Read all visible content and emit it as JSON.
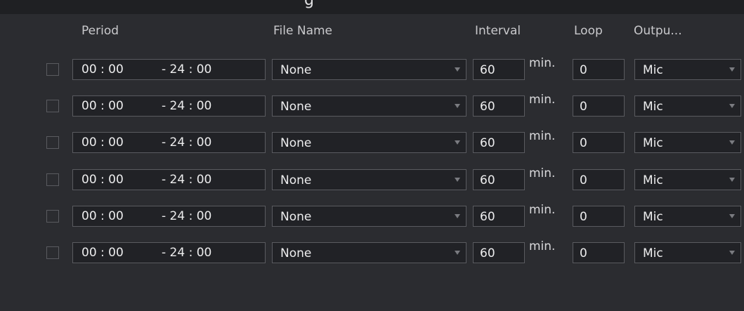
{
  "dialog": {
    "title_fragment": "g"
  },
  "headers": {
    "period": "Period",
    "file_name": "File Name",
    "interval": "Interval",
    "loop": "Loop",
    "output": "Outpu..."
  },
  "rows": [
    {
      "start": "00 : 00",
      "end": "- 24 : 00",
      "file": "None",
      "interval": "60",
      "unit": "min.",
      "loop": "0",
      "output": "Mic",
      "checked": false
    },
    {
      "start": "00 : 00",
      "end": "- 24 : 00",
      "file": "None",
      "interval": "60",
      "unit": "min.",
      "loop": "0",
      "output": "Mic",
      "checked": false
    },
    {
      "start": "00 : 00",
      "end": "- 24 : 00",
      "file": "None",
      "interval": "60",
      "unit": "min.",
      "loop": "0",
      "output": "Mic",
      "checked": false
    },
    {
      "start": "00 : 00",
      "end": "- 24 : 00",
      "file": "None",
      "interval": "60",
      "unit": "min.",
      "loop": "0",
      "output": "Mic",
      "checked": false
    },
    {
      "start": "00 : 00",
      "end": "- 24 : 00",
      "file": "None",
      "interval": "60",
      "unit": "min.",
      "loop": "0",
      "output": "Mic",
      "checked": false
    },
    {
      "start": "00 : 00",
      "end": "- 24 : 00",
      "file": "None",
      "interval": "60",
      "unit": "min.",
      "loop": "0",
      "output": "Mic",
      "checked": false
    }
  ],
  "colors": {
    "background": "#2b2c30",
    "field_background": "#212226",
    "border": "#5a5b60",
    "text": "#ededee"
  },
  "icons": {
    "dropdown": "caret-down-icon"
  }
}
